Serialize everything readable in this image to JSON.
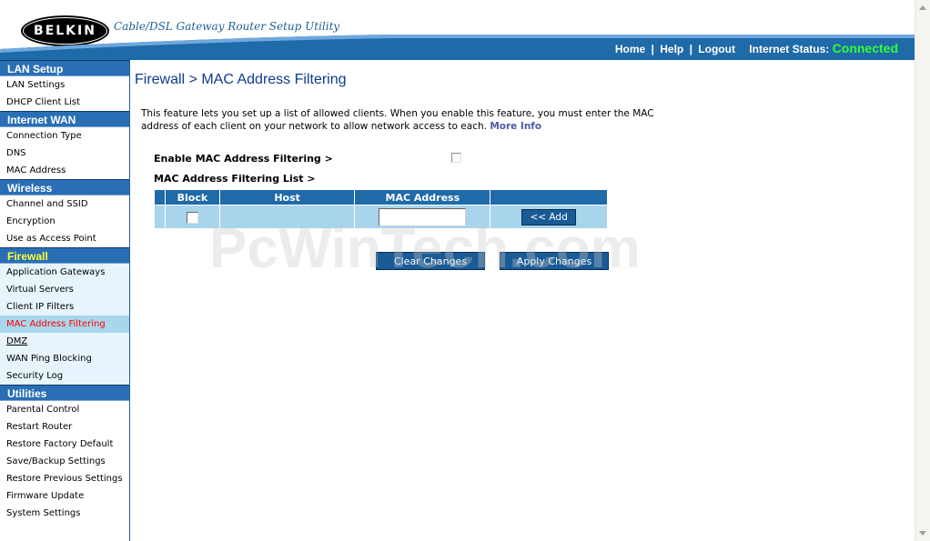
{
  "header": {
    "logo_text": "BELKIN",
    "tagline": "Cable/DSL Gateway Router Setup Utility",
    "nav": {
      "home": "Home",
      "help": "Help",
      "logout": "Logout",
      "sep": "|",
      "status_label": "Internet Status:",
      "status_value": "Connected"
    }
  },
  "sidebar": {
    "sections": [
      {
        "title": "LAN Setup",
        "items": [
          "LAN Settings",
          "DHCP Client List"
        ]
      },
      {
        "title": "Internet WAN",
        "items": [
          "Connection Type",
          "DNS",
          "MAC Address"
        ]
      },
      {
        "title": "Wireless",
        "items": [
          "Channel and SSID",
          "Encryption",
          "Use as Access Point"
        ]
      },
      {
        "title": "Firewall",
        "items": [
          "Application Gateways",
          "Virtual Servers",
          "Client IP Filters",
          "MAC Address Filtering",
          "DMZ",
          "WAN Ping Blocking",
          "Security Log"
        ]
      },
      {
        "title": "Utilities",
        "items": [
          "Parental Control",
          "Restart Router",
          "Restore Factory Default",
          "Save/Backup Settings",
          "Restore Previous Settings",
          "Firmware Update",
          "System Settings"
        ]
      }
    ]
  },
  "main": {
    "title": "Firewall > MAC Address Filtering",
    "intro": "This feature lets you set up a list of allowed clients. When you enable this feature, you must enter the MAC address of each client on your network to allow network access to each.",
    "more_info": "More Info",
    "enable_label": "Enable MAC Address Filtering >",
    "list_label": "MAC Address Filtering List >",
    "table": {
      "headers": [
        "Block",
        "Host",
        "MAC Address",
        ""
      ],
      "mac_value": "",
      "add_label": "<< Add"
    },
    "clear_label": "Clear Changes",
    "apply_label": "Apply Changes"
  },
  "watermark": "PcWinTech.com",
  "colors": {
    "brand_blue": "#2a6fb5",
    "status_green": "#33ff33",
    "active_item_red": "#ff0000",
    "firewall_yellow": "#ffff33"
  }
}
